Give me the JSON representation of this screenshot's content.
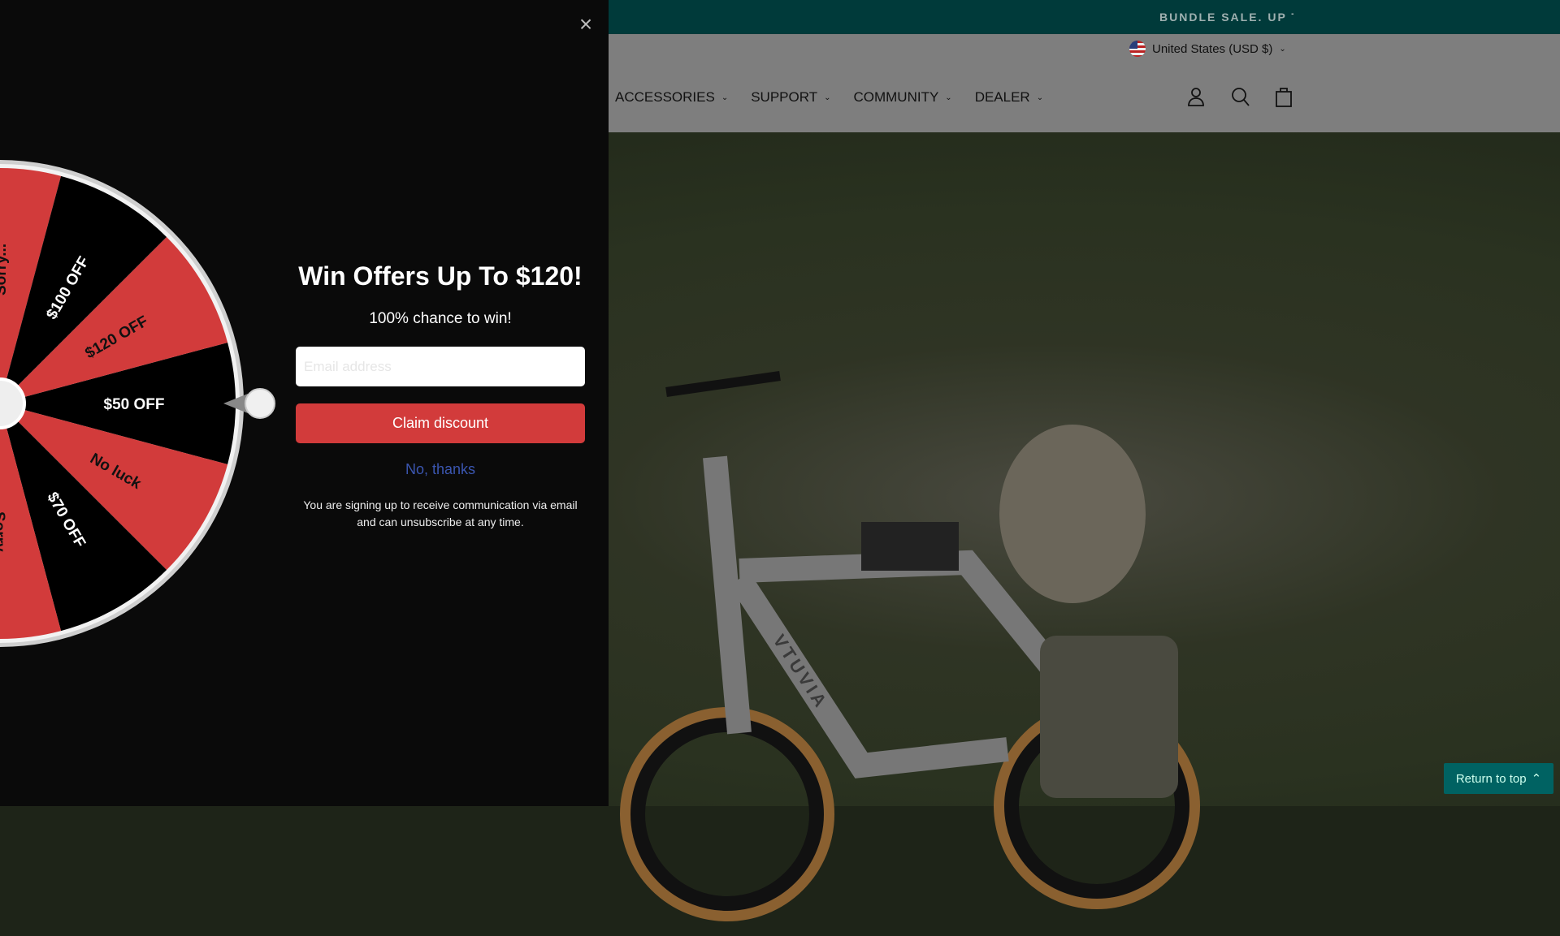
{
  "site": {
    "banner": "BUNDLE SALE. UP TO",
    "country": "United States (USD $)",
    "nav": [
      {
        "label": "ACCESSORIES"
      },
      {
        "label": "SUPPORT"
      },
      {
        "label": "COMMUNITY"
      },
      {
        "label": "DEALER"
      }
    ],
    "return_to_top": "Return to top",
    "bike_brand": "VTUVIA"
  },
  "popup": {
    "title": "Win Offers Up To $120!",
    "subtitle": "100% chance to win!",
    "email_placeholder": "Email address",
    "claim_label": "Claim discount",
    "no_thanks": "No, thanks",
    "disclaimer": "You are signing up to receive communication via email and can unsubscribe at any time.",
    "wheel": {
      "segments": [
        "$50 OFF",
        "No luck",
        "$70 OFF",
        "Sorry...",
        "",
        "",
        "",
        "",
        "",
        "Sorry...",
        "$100 OFF",
        "$120 OFF"
      ],
      "colors": {
        "red": "#d23b3b",
        "black": "#000000"
      }
    }
  }
}
